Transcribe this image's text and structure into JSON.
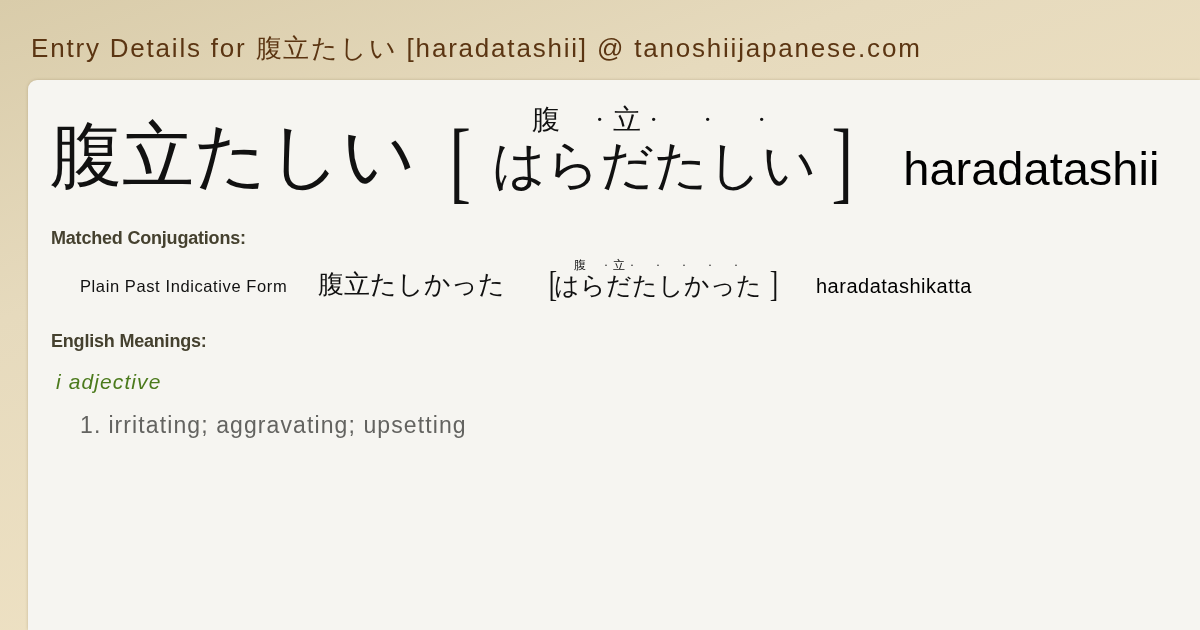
{
  "page": {
    "title": "Entry Details for 腹立たしい [haradatashii] @ tanoshiijapanese.com"
  },
  "entry": {
    "headword": "腹立たしい",
    "bracket_open": "[",
    "reading": [
      {
        "kana": "はら",
        "kanji": "腹"
      },
      {
        "kana": "だ",
        "kanji": "立",
        "mark": "·"
      },
      {
        "kana": "た",
        "mark": "·"
      },
      {
        "kana": "し",
        "mark": "·"
      },
      {
        "kana": "い",
        "mark": "·"
      }
    ],
    "bracket_close": "]",
    "romaji": "haradatashii"
  },
  "conjugations": {
    "heading": "Matched Conjugations:",
    "rows": [
      {
        "form": "Plain Past Indicative Form",
        "word": "腹立たしかった",
        "bracket_open": "[",
        "reading": [
          {
            "kana": "はら",
            "kanji": "腹"
          },
          {
            "kana": "だ",
            "kanji": "立",
            "mark": "·"
          },
          {
            "kana": "た",
            "mark": "·"
          },
          {
            "kana": "し",
            "mark": "·"
          },
          {
            "kana": "か",
            "mark": "·"
          },
          {
            "kana": "っ",
            "mark": "·"
          },
          {
            "kana": "た",
            "mark": "·"
          }
        ],
        "bracket_close": "]",
        "romaji": "haradatashikatta"
      }
    ]
  },
  "meanings": {
    "heading": "English Meanings:",
    "part_of_speech": "i adjective",
    "senses": [
      {
        "number": "1.",
        "text": "irritating; aggravating; upsetting"
      }
    ]
  }
}
